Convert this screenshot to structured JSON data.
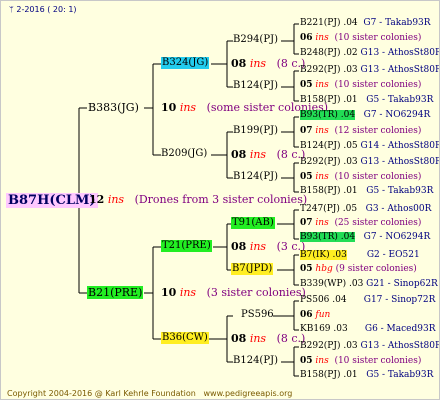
{
  "header": {
    "date": "2-2016 ( 20: 1)"
  },
  "footer": {
    "copyright": "Copyright 2004-2016 @ Karl Kehrle Foundation",
    "url": "www.pedigreeapis.org"
  },
  "root": {
    "label": "B87H(CLM)",
    "num": "12",
    "ins": "ins",
    "note": "(Drones from 3 sister colonies)"
  },
  "gen2": {
    "a": {
      "label": "B383(JG)",
      "num": "10",
      "ins": "ins",
      "note": "(some sister colonies)"
    },
    "b": {
      "label": "B21(PRE)",
      "num": "10",
      "ins": "ins",
      "note": "(3 sister colonies)"
    }
  },
  "gen3": {
    "b324": {
      "label": "B324(JG)",
      "num": "08",
      "ins": "ins",
      "note": "(8 c.)"
    },
    "b209": {
      "label": "B209(JG)",
      "num": "08",
      "ins": "ins",
      "note": "(8 c.)"
    },
    "t21": {
      "label": "T21(PRE)",
      "num": "08",
      "ins": "ins",
      "note": "(3 c.)"
    },
    "b36": {
      "label": "B36(CW)",
      "num": "08",
      "ins": "ins",
      "note": "(8 c.)"
    }
  },
  "gen4": {
    "b294": "B294(PJ)",
    "b124a": "B124(PJ)",
    "b199": "B199(PJ)",
    "b124b": "B124(PJ)",
    "t91": "T91(AB)",
    "b7": "B7(JPD)",
    "ps596": "PS596",
    "b124c": "B124(PJ)"
  },
  "gen5": [
    {
      "a": "B221(PJ) .04",
      "g": "G7 - Takab93R"
    },
    {
      "num": "06",
      "ins": "ins",
      "note": "(10 sister colonies)"
    },
    {
      "a": "B248(PJ) .02",
      "g": "G13 - AthosSt80R"
    },
    {
      "a": "B292(PJ) .03",
      "g": "G13 - AthosSt80R"
    },
    {
      "num": "05",
      "ins": "ins",
      "note": "(10 sister colonies)"
    },
    {
      "a": "B158(PJ) .01",
      "g": "G5 - Takab93R"
    },
    {
      "a": "B93(TR) .04",
      "g": "G7 - NO6294R"
    },
    {
      "num": "07",
      "ins": "ins",
      "note": "(12 sister colonies)"
    },
    {
      "a": "B124(PJ) .05",
      "g": "G14 - AthosSt80R"
    },
    {
      "a": "B292(PJ) .03",
      "g": "G13 - AthosSt80R"
    },
    {
      "num": "05",
      "ins": "ins",
      "note": "(10 sister colonies)"
    },
    {
      "a": "B158(PJ) .01",
      "g": "G5 - Takab93R"
    },
    {
      "a": "T247(PJ) .05",
      "g": "G3 - Athos00R"
    },
    {
      "num": "07",
      "ins": "ins",
      "note": "(25 sister colonies)"
    },
    {
      "a": "B93(TR) .04",
      "g": "G7 - NO6294R"
    },
    {
      "a": "B7(IK) .03",
      "g": "G2 - EO521"
    },
    {
      "num": "05",
      "ins": "hbg",
      "note": "(9 sister colonies)"
    },
    {
      "a": "B339(WP) .03",
      "g": "G21 - Sinop62R"
    },
    {
      "a": "PS506 .04",
      "g": "G17 - Sinop72R"
    },
    {
      "num": "06",
      "ins": "fun",
      "note": ""
    },
    {
      "a": "KB169 .03",
      "g": "G6 - Maced93R"
    },
    {
      "a": "B292(PJ) .03",
      "g": "G13 - AthosSt80R"
    },
    {
      "num": "05",
      "ins": "ins",
      "note": "(10 sister colonies)"
    },
    {
      "a": "B158(PJ) .01",
      "g": "G5 - Takab93R"
    }
  ],
  "colors": {
    "background": "#ffffe0",
    "insect": "#ff0000",
    "note": "#800080",
    "root_bg": "#ffc8ff",
    "cyan": "#22ccee",
    "green": "#22ee22",
    "yellow": "#ffee22"
  }
}
